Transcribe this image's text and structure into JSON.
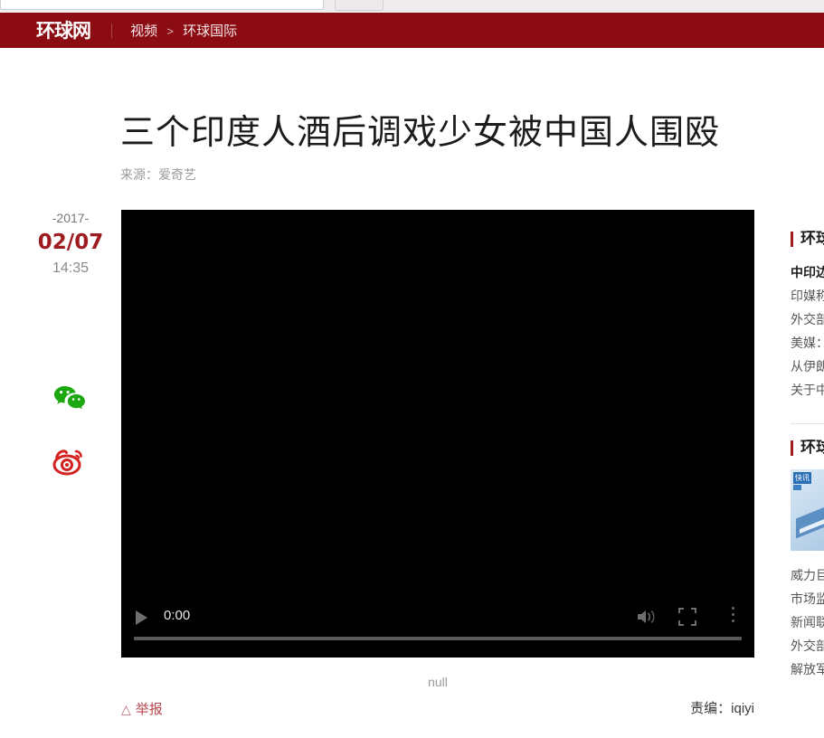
{
  "browser_chrome": {
    "omnibox_value": "",
    "button_label": ""
  },
  "header": {
    "logo": "环球网",
    "breadcrumb": {
      "section": "视频",
      "separator": ">",
      "category": "环球国际"
    },
    "background_color": "#8c0c13"
  },
  "article": {
    "title": "三个印度人酒后调戏少女被中国人围殴",
    "source_label": "来源：爱奇艺",
    "published": {
      "year": "-2017-",
      "date": "02/07",
      "time": "14:35",
      "date_color": "#9e1b20"
    },
    "caption": "null",
    "report_label": "举报",
    "report_icon": "warning-triangle-icon",
    "editor_label": "责编：iqiyi"
  },
  "share": {
    "items": [
      {
        "name": "wechat",
        "icon": "wechat-icon",
        "color": "#1ca811"
      },
      {
        "name": "weibo",
        "icon": "weibo-icon",
        "color": "#d3221f"
      }
    ]
  },
  "video_player": {
    "play_icon": "play-icon",
    "current_time": "0:00",
    "volume_icon": "volume-icon",
    "fullscreen_icon": "fullscreen-icon",
    "more_icon": "more-vertical-icon",
    "progress_percent": 0,
    "poster_color": "#000000"
  },
  "sidebar": {
    "blocks": [
      {
        "heading": "环球热点",
        "items": [
          {
            "text": "中印边境对峙",
            "lead": true
          },
          {
            "text": "印媒称中方…",
            "lead": false
          },
          {
            "text": "外交部回应…",
            "lead": false
          },
          {
            "text": "美媒：中国…",
            "lead": false
          },
          {
            "text": "从伊朗到朝…",
            "lead": false
          },
          {
            "text": "关于中印边…",
            "lead": false
          }
        ]
      },
      {
        "heading": "环球视频",
        "thumbnail": {
          "tag": "快讯",
          "alt": "news-thumbnail"
        },
        "items": [
          {
            "text": "威力巨大的…",
            "lead": false
          },
          {
            "text": "市场监管部…",
            "lead": false
          },
          {
            "text": "新闻联播报…",
            "lead": false
          },
          {
            "text": "外交部：中…",
            "lead": false
          },
          {
            "text": "解放军演习…",
            "lead": false
          }
        ]
      }
    ]
  }
}
